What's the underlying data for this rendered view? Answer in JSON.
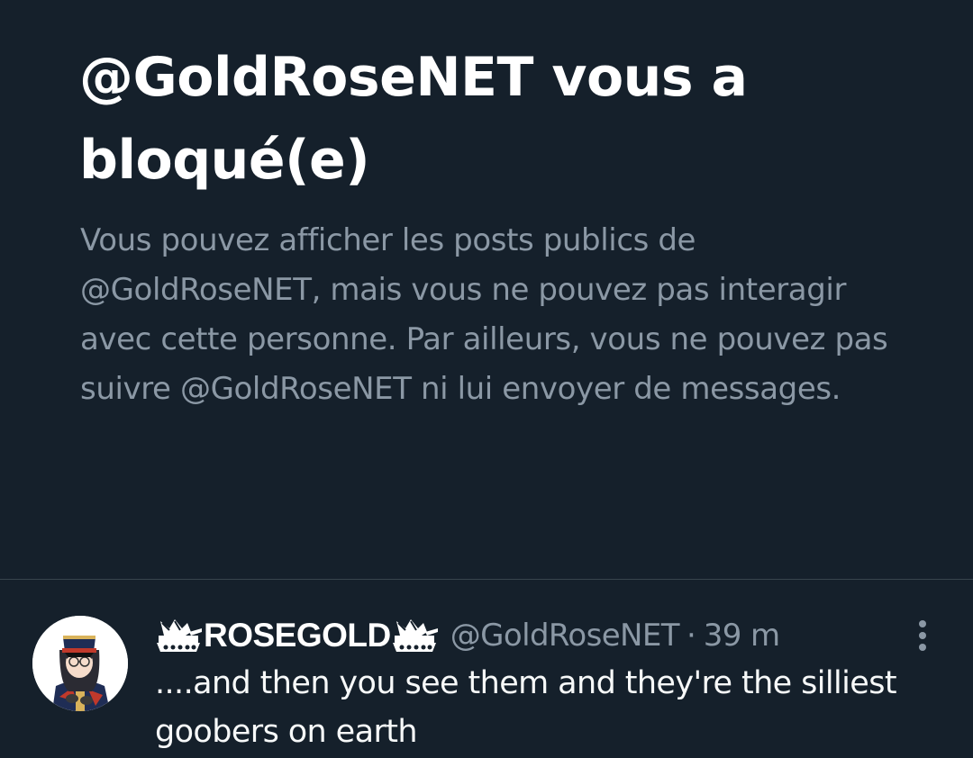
{
  "blocked": {
    "title": "@GoldRoseNET vous a bloqué(e)",
    "description": "Vous pouvez afficher les posts publics de @GoldRoseNET, mais vous ne pouvez pas interagir avec cette personne. Par ailleurs, vous ne pouvez pas suivre @GoldRoseNET ni lui envoyer de messages."
  },
  "post": {
    "display_name": "ROSEGOLD",
    "name_emblem_icon": "tank-emoji-icon",
    "handle": "@GoldRoseNET",
    "separator": "·",
    "time": "39 m",
    "text": "....and then you see them and they're the silliest goobers on earth",
    "more_icon": "more-vertical-icon",
    "avatar_icon": "anime-officer-avatar"
  },
  "colors": {
    "background": "#15202b",
    "primary_text": "#ffffff",
    "secondary_text": "#8b98a5",
    "divider": "#38444d"
  }
}
